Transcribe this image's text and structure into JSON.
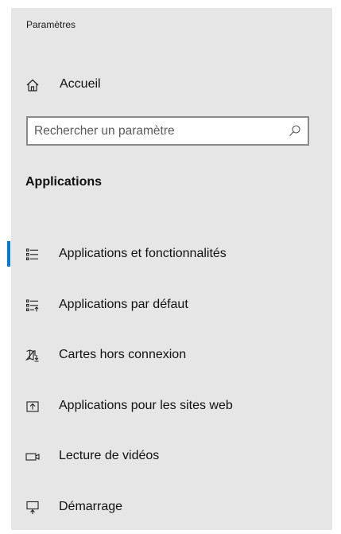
{
  "window": {
    "title": "Paramètres"
  },
  "home": {
    "label": "Accueil",
    "icon": "home-icon"
  },
  "search": {
    "placeholder": "Rechercher un paramètre",
    "value": "",
    "icon": "search-icon"
  },
  "section": {
    "title": "Applications"
  },
  "accent_color": "#0078d7",
  "nav": {
    "items": [
      {
        "label": "Applications et fonctionnalités",
        "icon": "apps-features-icon",
        "selected": true
      },
      {
        "label": "Applications par défaut",
        "icon": "default-apps-icon",
        "selected": false
      },
      {
        "label": "Cartes hors connexion",
        "icon": "offline-maps-icon",
        "selected": false
      },
      {
        "label": "Applications pour les sites web",
        "icon": "apps-for-websites-icon",
        "selected": false
      },
      {
        "label": "Lecture de vidéos",
        "icon": "video-playback-icon",
        "selected": false
      },
      {
        "label": "Démarrage",
        "icon": "startup-icon",
        "selected": false
      }
    ]
  }
}
